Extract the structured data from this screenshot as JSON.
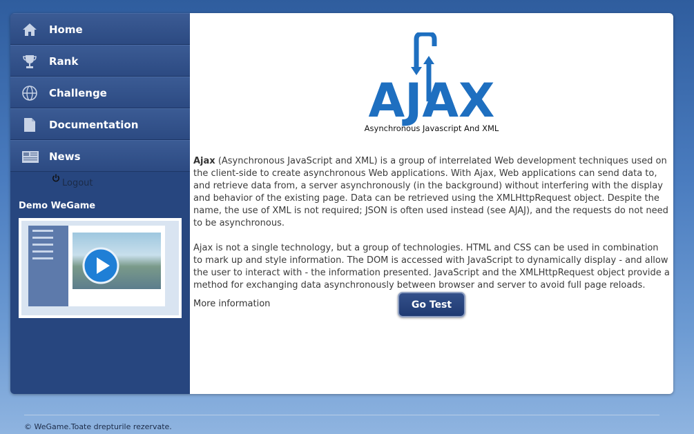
{
  "sidebar": {
    "items": [
      {
        "label": "Home",
        "icon": "home-icon"
      },
      {
        "label": "Rank",
        "icon": "trophy-icon"
      },
      {
        "label": "Challenge",
        "icon": "globe-icon"
      },
      {
        "label": "Documentation",
        "icon": "document-icon"
      },
      {
        "label": "News",
        "icon": "newspaper-icon"
      }
    ],
    "logout_label": "Logout",
    "demo_title": "Demo WeGame"
  },
  "main": {
    "logo": {
      "title": "AJAX",
      "subtitle": "Asynchronous Javascript And XML"
    },
    "paragraph1_bold": "Ajax",
    "paragraph1_rest": " (Asynchronous JavaScript and XML) is a group of interrelated Web development techniques used on the client-side to create asynchronous Web applications. With Ajax, Web applications can send data to, and retrieve data from, a server asynchronously (in the background) without interfering with the display and behavior of the existing page. Data can be retrieved using the XMLHttpRequest object. Despite the name, the use of XML is not required; JSON is often used instead (see AJAJ), and the requests do not need to be asynchronous.",
    "paragraph2": "Ajax is not a single technology, but a group of technologies. HTML and CSS can be used in combination to mark up and style information. The DOM is accessed with JavaScript to dynamically display - and allow the user to interact with - the information presented. JavaScript and the XMLHttpRequest object provide a method for exchanging data asynchronously between browser and server to avoid full page reloads.",
    "more_info_label": "More information",
    "go_test_label": "Go Test"
  },
  "footer": {
    "text": "© WeGame.Toate drepturile rezervate."
  },
  "colors": {
    "sidebar_bg": "#27467f",
    "nav_item": "#34558f",
    "logo_blue": "#1e6fc0",
    "button_bg": "#2a4580"
  }
}
